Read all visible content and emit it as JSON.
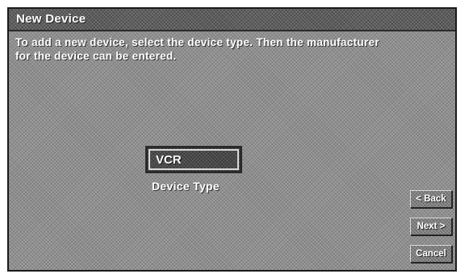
{
  "window": {
    "title": "New Device"
  },
  "instructions": {
    "line1": "To add a new device, select the device type.  Then the manufacturer",
    "line2": "for the device can be entered."
  },
  "device_type": {
    "value": "VCR",
    "label": "Device Type"
  },
  "buttons": {
    "back": "< Back",
    "next": "Next >",
    "cancel": "Cancel"
  }
}
